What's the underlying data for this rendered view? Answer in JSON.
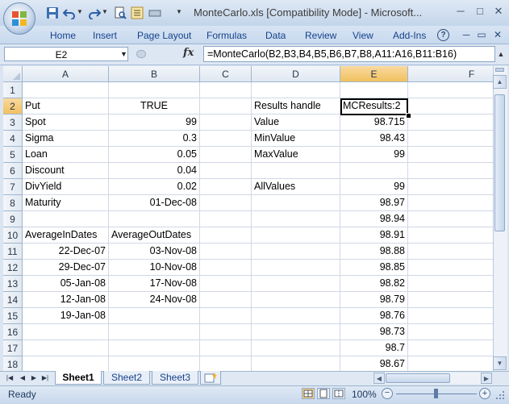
{
  "window": {
    "title": "MonteCarlo.xls  [Compatibility Mode] - Microsoft...",
    "minimize_glyph": "─",
    "maximize_glyph": "□",
    "close_glyph": "✕"
  },
  "ribbon": {
    "tabs": [
      "Home",
      "Insert",
      "Page Layout",
      "Formulas",
      "Data",
      "Review",
      "View",
      "Add-Ins"
    ],
    "help_glyph": "?",
    "restore_glyph": "▭",
    "close_glyph": "✕"
  },
  "formula_bar": {
    "name_box": "E2",
    "fx": "fx",
    "formula": "=MonteCarlo(B2,B3,B4,B5,B6,B7,B8,A11:A16,B11:B16)"
  },
  "grid": {
    "columns": [
      "A",
      "B",
      "C",
      "D",
      "E",
      "F"
    ],
    "rows": [
      "1",
      "2",
      "3",
      "4",
      "5",
      "6",
      "7",
      "8",
      "9",
      "10",
      "11",
      "12",
      "13",
      "14",
      "15",
      "16",
      "17",
      "18"
    ],
    "active_cell": "E2",
    "cells": {
      "A2": "Put",
      "B2": "TRUE",
      "D2": "Results handle",
      "E2": "MCResults:2",
      "A3": "Spot",
      "B3": "99",
      "D3": "Value",
      "E3": "98.715",
      "A4": "Sigma",
      "B4": "0.3",
      "D4": "MinValue",
      "E4": "98.43",
      "A5": "Loan",
      "B5": "0.05",
      "D5": "MaxValue",
      "E5": "99",
      "A6": "Discount",
      "B6": "0.04",
      "A7": "DivYield",
      "B7": "0.02",
      "D7": "AllValues",
      "E7": "99",
      "A8": "Maturity",
      "B8": "01-Dec-08",
      "E8": "98.97",
      "E9": "98.94",
      "A10": "AverageInDates",
      "B10": "AverageOutDates",
      "E10": "98.91",
      "A11": "22-Dec-07",
      "B11": "03-Nov-08",
      "E11": "98.88",
      "A12": "29-Dec-07",
      "B12": "10-Nov-08",
      "E12": "98.85",
      "A13": "05-Jan-08",
      "B13": "17-Nov-08",
      "E13": "98.82",
      "A14": "12-Jan-08",
      "B14": "24-Nov-08",
      "E14": "98.79",
      "A15": "19-Jan-08",
      "E15": "98.76",
      "E16": "98.73",
      "E17": "98.7",
      "E18": "98.67"
    }
  },
  "sheets": {
    "tabs": [
      "Sheet1",
      "Sheet2",
      "Sheet3"
    ],
    "active": "Sheet1"
  },
  "status": {
    "text": "Ready",
    "zoom": "100%",
    "minus": "−",
    "plus": "+"
  },
  "colors": {
    "accent": "#15428b",
    "selected_header": "#f1c15f"
  }
}
